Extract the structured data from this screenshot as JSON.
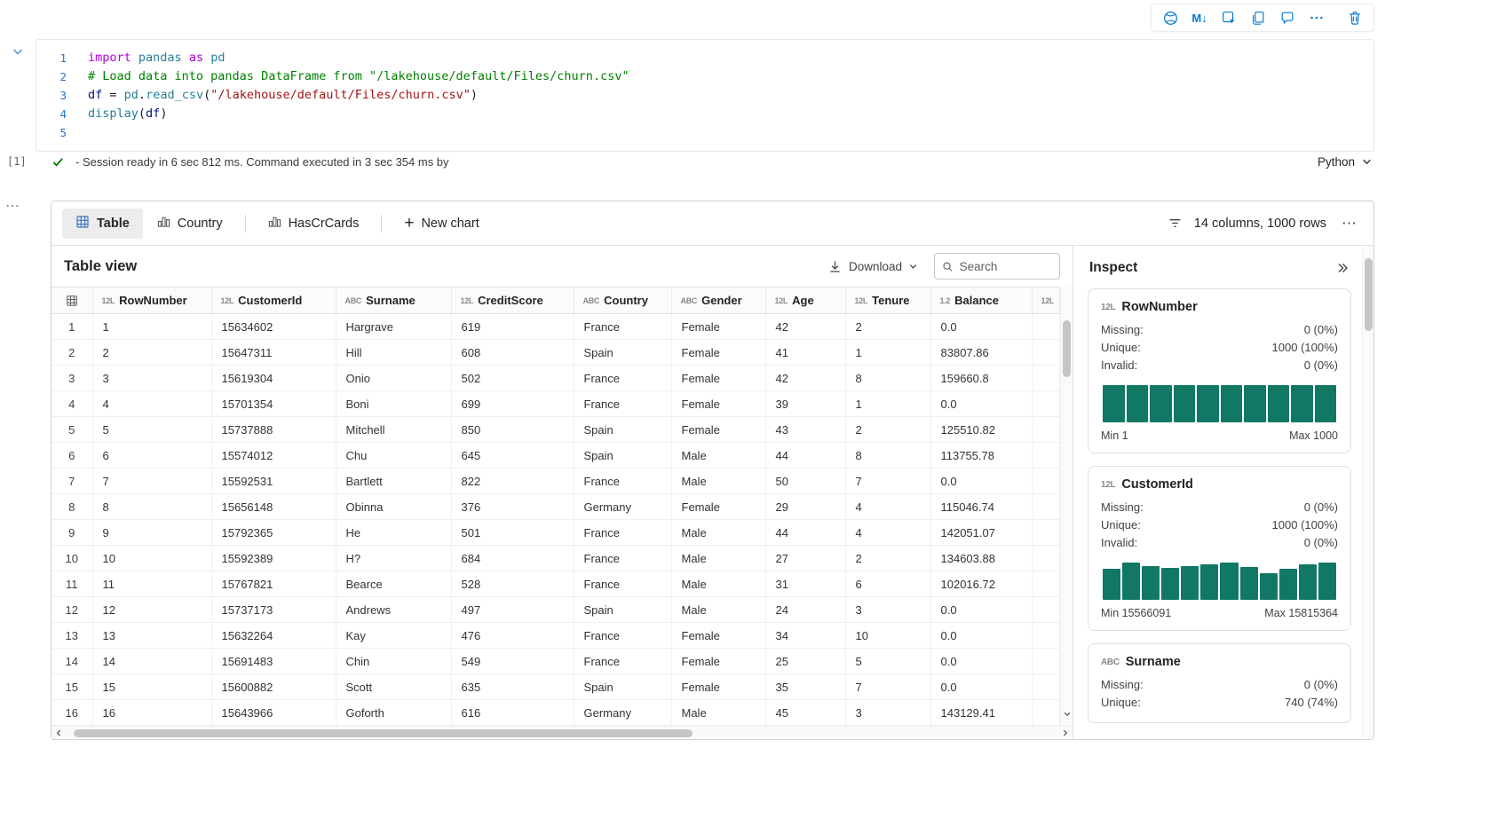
{
  "colors": {
    "accent": "#0078d4",
    "histogram_bar": "#117865",
    "success_check": "#107c10"
  },
  "cell_toolbar": {
    "markdown_label": "M↓",
    "icons": [
      "copilot-icon",
      "convert-to-markdown-icon",
      "select-cell-icon",
      "duplicate-cell-icon",
      "comment-icon",
      "more-options-icon",
      "delete-cell-icon"
    ]
  },
  "code_cell": {
    "lines": [
      {
        "n": "1",
        "tokens": [
          {
            "t": "kw",
            "v": "import"
          },
          {
            "t": "pln",
            "v": " "
          },
          {
            "t": "mod",
            "v": "pandas"
          },
          {
            "t": "pln",
            "v": " "
          },
          {
            "t": "kw",
            "v": "as"
          },
          {
            "t": "pln",
            "v": " "
          },
          {
            "t": "mod",
            "v": "pd"
          }
        ]
      },
      {
        "n": "2",
        "tokens": [
          {
            "t": "cmt",
            "v": "# Load data into pandas DataFrame from \"/lakehouse/default/Files/churn.csv\""
          }
        ]
      },
      {
        "n": "3",
        "tokens": [
          {
            "t": "var",
            "v": "df"
          },
          {
            "t": "pln",
            "v": " = "
          },
          {
            "t": "mod",
            "v": "pd"
          },
          {
            "t": "pln",
            "v": "."
          },
          {
            "t": "fn",
            "v": "read_csv"
          },
          {
            "t": "pln",
            "v": "("
          },
          {
            "t": "str",
            "v": "\"/lakehouse/default/Files/churn.csv\""
          },
          {
            "t": "pln",
            "v": ")"
          }
        ]
      },
      {
        "n": "4",
        "tokens": [
          {
            "t": "fn",
            "v": "display"
          },
          {
            "t": "pln",
            "v": "("
          },
          {
            "t": "var",
            "v": "df"
          },
          {
            "t": "pln",
            "v": ")"
          }
        ]
      },
      {
        "n": "5",
        "tokens": []
      }
    ]
  },
  "status_bar": {
    "execution_count": "[1]",
    "message": "- Session ready in 6 sec 812 ms. Command executed in 3 sec 354 ms by",
    "language": "Python"
  },
  "output": {
    "tabs": [
      {
        "label": "Table",
        "icon": "table-grid-icon",
        "active": true
      },
      {
        "label": "Country",
        "icon": "bar-chart-icon",
        "active": false
      },
      {
        "label": "HasCrCards",
        "icon": "bar-chart-icon",
        "active": false
      }
    ],
    "new_chart_label": "New chart",
    "summary": "14 columns, 1000 rows",
    "table_view": {
      "title": "Table view",
      "download_label": "Download",
      "search_placeholder": "Search"
    },
    "grid": {
      "columns": [
        {
          "badge": "12L",
          "name": "RowNumber"
        },
        {
          "badge": "12L",
          "name": "CustomerId"
        },
        {
          "badge": "ABC",
          "name": "Surname"
        },
        {
          "badge": "12L",
          "name": "CreditScore"
        },
        {
          "badge": "ABC",
          "name": "Country"
        },
        {
          "badge": "ABC",
          "name": "Gender"
        },
        {
          "badge": "12L",
          "name": "Age"
        },
        {
          "badge": "12L",
          "name": "Tenure"
        },
        {
          "badge": "1.2",
          "name": "Balance"
        },
        {
          "badge": "12L",
          "name": ""
        }
      ],
      "rows": [
        [
          "1",
          "15634602",
          "Hargrave",
          "619",
          "France",
          "Female",
          "42",
          "2",
          "0.0"
        ],
        [
          "2",
          "15647311",
          "Hill",
          "608",
          "Spain",
          "Female",
          "41",
          "1",
          "83807.86"
        ],
        [
          "3",
          "15619304",
          "Onio",
          "502",
          "France",
          "Female",
          "42",
          "8",
          "159660.8"
        ],
        [
          "4",
          "15701354",
          "Boni",
          "699",
          "France",
          "Female",
          "39",
          "1",
          "0.0"
        ],
        [
          "5",
          "15737888",
          "Mitchell",
          "850",
          "Spain",
          "Female",
          "43",
          "2",
          "125510.82"
        ],
        [
          "6",
          "15574012",
          "Chu",
          "645",
          "Spain",
          "Male",
          "44",
          "8",
          "113755.78"
        ],
        [
          "7",
          "15592531",
          "Bartlett",
          "822",
          "France",
          "Male",
          "50",
          "7",
          "0.0"
        ],
        [
          "8",
          "15656148",
          "Obinna",
          "376",
          "Germany",
          "Female",
          "29",
          "4",
          "115046.74"
        ],
        [
          "9",
          "15792365",
          "He",
          "501",
          "France",
          "Male",
          "44",
          "4",
          "142051.07"
        ],
        [
          "10",
          "15592389",
          "H?",
          "684",
          "France",
          "Male",
          "27",
          "2",
          "134603.88"
        ],
        [
          "11",
          "15767821",
          "Bearce",
          "528",
          "France",
          "Male",
          "31",
          "6",
          "102016.72"
        ],
        [
          "12",
          "15737173",
          "Andrews",
          "497",
          "Spain",
          "Male",
          "24",
          "3",
          "0.0"
        ],
        [
          "13",
          "15632264",
          "Kay",
          "476",
          "France",
          "Female",
          "34",
          "10",
          "0.0"
        ],
        [
          "14",
          "15691483",
          "Chin",
          "549",
          "France",
          "Female",
          "25",
          "5",
          "0.0"
        ],
        [
          "15",
          "15600882",
          "Scott",
          "635",
          "Spain",
          "Female",
          "35",
          "7",
          "0.0"
        ],
        [
          "16",
          "15643966",
          "Goforth",
          "616",
          "Germany",
          "Male",
          "45",
          "3",
          "143129.41"
        ]
      ]
    },
    "inspect": {
      "title": "Inspect",
      "cards": [
        {
          "badge": "12L",
          "name": "RowNumber",
          "stats": [
            [
              "Missing:",
              "0 (0%)"
            ],
            [
              "Unique:",
              "1000 (100%)"
            ],
            [
              "Invalid:",
              "0 (0%)"
            ]
          ],
          "histogram": [
            1,
            1,
            1,
            1,
            1,
            1,
            1,
            1,
            1,
            1
          ],
          "min_label": "Min 1",
          "max_label": "Max 1000"
        },
        {
          "badge": "12L",
          "name": "CustomerId",
          "stats": [
            [
              "Missing:",
              "0 (0%)"
            ],
            [
              "Unique:",
              "1000 (100%)"
            ],
            [
              "Invalid:",
              "0 (0%)"
            ]
          ],
          "histogram": [
            0.84,
            1,
            0.9,
            0.86,
            0.9,
            0.95,
            1,
            0.88,
            0.72,
            0.84,
            0.95,
            1
          ],
          "min_label": "Min 15566091",
          "max_label": "Max 15815364"
        },
        {
          "badge": "ABC",
          "name": "Surname",
          "stats": [
            [
              "Missing:",
              "0 (0%)"
            ],
            [
              "Unique:",
              "740 (74%)"
            ]
          ],
          "histogram": null,
          "min_label": null,
          "max_label": null
        }
      ]
    }
  }
}
